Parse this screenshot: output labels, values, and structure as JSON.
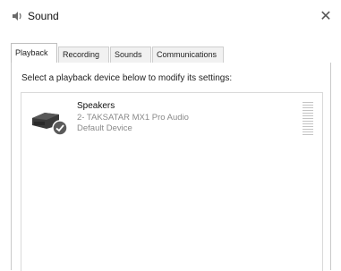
{
  "window": {
    "title": "Sound"
  },
  "tabs": [
    {
      "label": "Playback",
      "active": true
    },
    {
      "label": "Recording",
      "active": false
    },
    {
      "label": "Sounds",
      "active": false
    },
    {
      "label": "Communications",
      "active": false
    }
  ],
  "playback": {
    "instruction": "Select a playback device below to modify its settings:",
    "devices": [
      {
        "name": "Speakers",
        "description": "2- TAKSATAR MX1 Pro Audio",
        "status": "Default Device",
        "icon": "speaker-icon",
        "default_badge": "check-icon"
      }
    ]
  },
  "colors": {
    "default_badge": "#5a5a5a",
    "speaker_body": "#3a3a3a"
  }
}
